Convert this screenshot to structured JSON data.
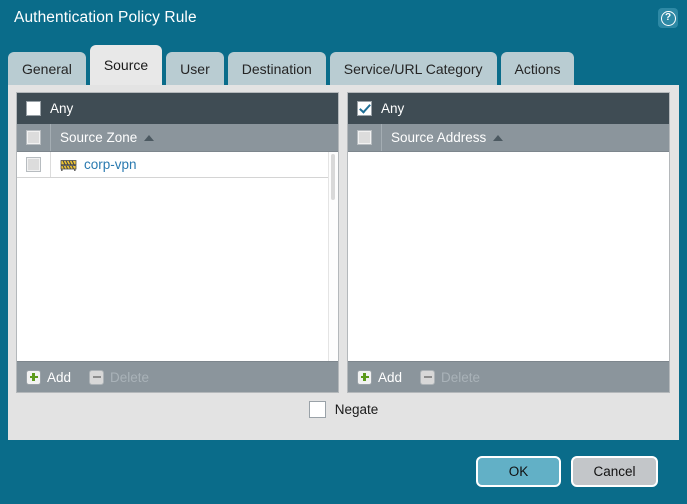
{
  "window": {
    "title": "Authentication Policy Rule",
    "help_icon": "help-circle-icon",
    "help_glyph": "?"
  },
  "tabs": [
    {
      "label": "General",
      "active": false
    },
    {
      "label": "Source",
      "active": true
    },
    {
      "label": "User",
      "active": false
    },
    {
      "label": "Destination",
      "active": false
    },
    {
      "label": "Service/URL Category",
      "active": false
    },
    {
      "label": "Actions",
      "active": false
    }
  ],
  "panels": {
    "source_zone": {
      "any_label": "Any",
      "any_checked": false,
      "column_header": "Source Zone",
      "sort_direction": "asc",
      "rows": [
        {
          "label": "corp-vpn",
          "icon": "zone-barrier-icon",
          "checked": false
        }
      ],
      "toolbar": {
        "add_label": "Add",
        "add_icon": "plus-icon",
        "delete_label": "Delete",
        "delete_icon": "minus-icon",
        "delete_disabled": true
      }
    },
    "source_address": {
      "any_label": "Any",
      "any_checked": true,
      "column_header": "Source Address",
      "sort_direction": "asc",
      "rows": [],
      "toolbar": {
        "add_label": "Add",
        "add_icon": "plus-icon",
        "delete_label": "Delete",
        "delete_icon": "minus-icon",
        "delete_disabled": true
      }
    }
  },
  "negate": {
    "label": "Negate",
    "checked": false
  },
  "footer": {
    "ok_label": "OK",
    "cancel_label": "Cancel"
  },
  "colors": {
    "titlebar": "#0a6c8a",
    "tab_inactive": "#b9ccd2",
    "tab_active": "#e8e8e8",
    "content_bg": "#e3e3e3",
    "any_bar": "#3f4c54",
    "column_header": "#8b959c",
    "link": "#2a7ab0",
    "ok_button": "#62b0c6",
    "cancel_button": "#c3c6c9",
    "plus_green": "#5c9a1b"
  }
}
